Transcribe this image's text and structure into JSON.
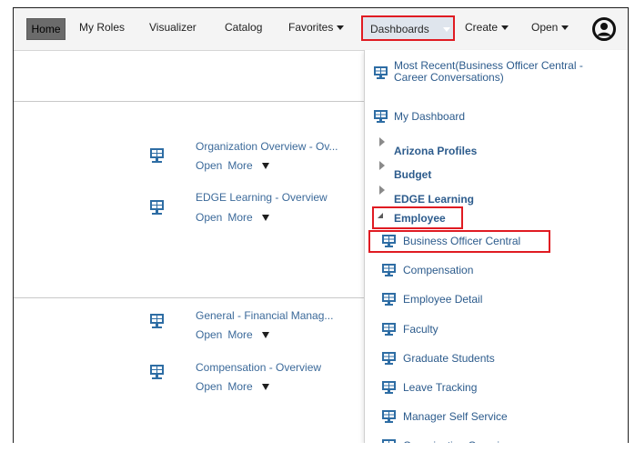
{
  "nav": {
    "home": "Home",
    "my_roles": "My Roles",
    "visualizer": "Visualizer",
    "catalog": "Catalog",
    "favorites": "Favorites",
    "dashboards": "Dashboards",
    "create": "Create",
    "open": "Open",
    "icons": {
      "user": "user-avatar-icon",
      "caret": "caret-down-icon"
    }
  },
  "tiles": [
    {
      "title": "Organization Overview - Ov...",
      "open": "Open",
      "more": "More"
    },
    {
      "title": "EDGE Learning - Overview",
      "open": "Open",
      "more": "More"
    },
    {
      "title": "General - Financial Manag...",
      "open": "Open",
      "more": "More"
    },
    {
      "title": "Compensation - Overview",
      "open": "Open",
      "more": "More"
    }
  ],
  "menu": {
    "most_recent_line1": "Most Recent(Business Officer Central -",
    "most_recent_line2": "Career Conversations)",
    "my_dashboard": "My Dashboard",
    "folders": [
      "Arizona Profiles",
      "Budget",
      "EDGE Learning"
    ],
    "open_folder": "Employee",
    "items": [
      "Business Officer Central",
      "Compensation",
      "Employee Detail",
      "Faculty",
      "Graduate Students",
      "Leave Tracking",
      "Manager Self Service",
      "Organization Overview"
    ]
  },
  "colors": {
    "highlight": "#e01b22",
    "link": "#2c5b8c",
    "home_bg": "#6b6b6b",
    "dashboard_icon": "#2e6da4"
  }
}
